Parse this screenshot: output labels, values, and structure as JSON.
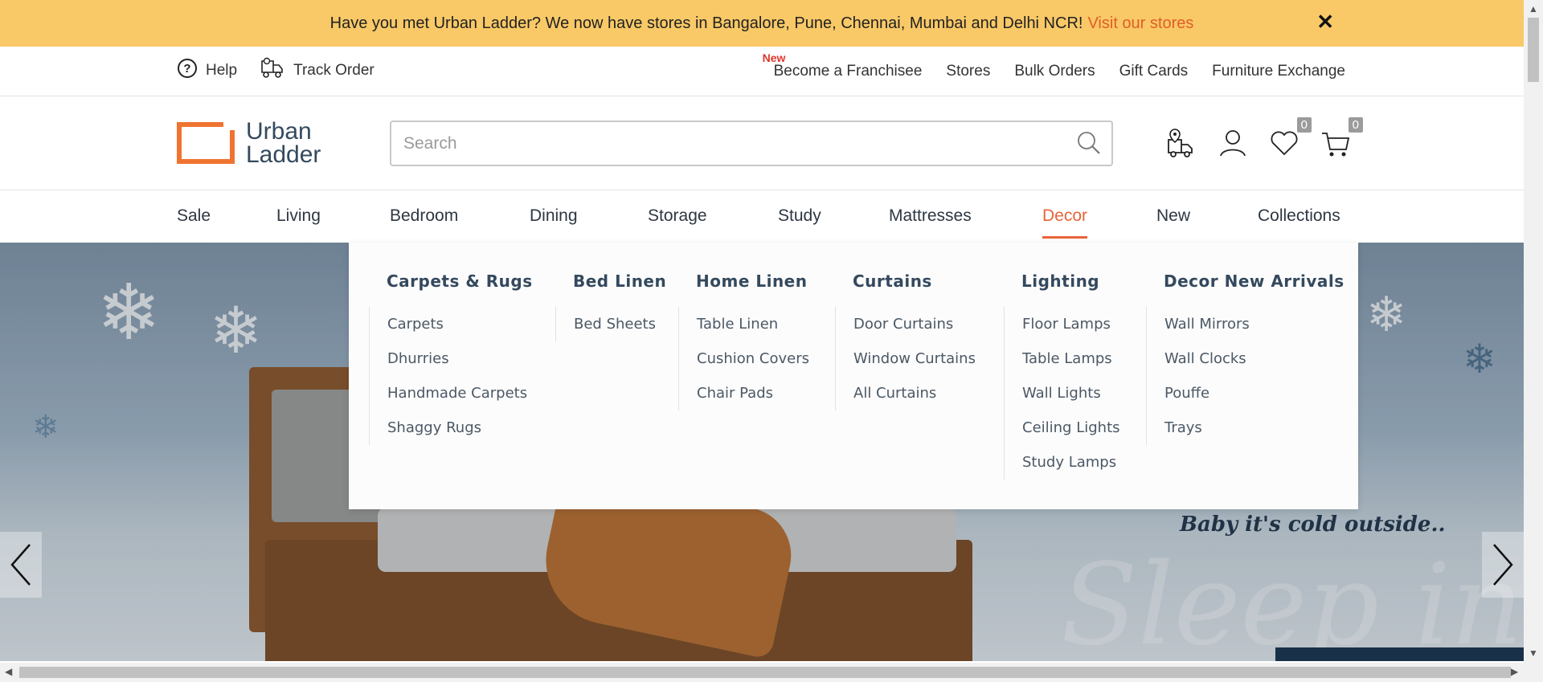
{
  "announcement": {
    "text": "Have you met Urban Ladder? We now have stores in Bangalore, Pune, Chennai, Mumbai and Delhi NCR!",
    "link": "Visit our stores",
    "close": "✕"
  },
  "utility": {
    "help": "Help",
    "track_order": "Track Order",
    "new_tag": "New",
    "links": [
      "Become a Franchisee",
      "Stores",
      "Bulk Orders",
      "Gift Cards",
      "Furniture Exchange"
    ]
  },
  "header": {
    "logo_line1": "Urban",
    "logo_line2": "Ladder",
    "search_placeholder": "Search",
    "wishlist_count": "0",
    "cart_count": "0"
  },
  "nav": {
    "items": [
      "Sale",
      "Living",
      "Bedroom",
      "Dining",
      "Storage",
      "Study",
      "Mattresses",
      "Decor",
      "New",
      "Collections"
    ],
    "active": "Decor"
  },
  "mega_menu": {
    "columns": [
      {
        "title": "Carpets & Rugs",
        "links": [
          "Carpets",
          "Dhurries",
          "Handmade Carpets",
          "Shaggy Rugs"
        ]
      },
      {
        "title": "Bed Linen",
        "links": [
          "Bed Sheets"
        ]
      },
      {
        "title": "Home Linen",
        "links": [
          "Table Linen",
          "Cushion Covers",
          "Chair Pads"
        ]
      },
      {
        "title": "Curtains",
        "links": [
          "Door Curtains",
          "Window Curtains",
          "All Curtains"
        ]
      },
      {
        "title": "Lighting",
        "links": [
          "Floor Lamps",
          "Table Lamps",
          "Wall Lights",
          "Ceiling Lights",
          "Study Lamps"
        ]
      },
      {
        "title": "Decor New Arrivals",
        "links": [
          "Wall Mirrors",
          "Wall Clocks",
          "Pouffe",
          "Trays"
        ]
      }
    ]
  },
  "hero": {
    "tagline": "Baby it's cold outside..",
    "script": "Sleep in"
  },
  "colors": {
    "announcement_bg": "#f9c967",
    "accent": "#e8643a",
    "text_dark": "#34495e"
  }
}
